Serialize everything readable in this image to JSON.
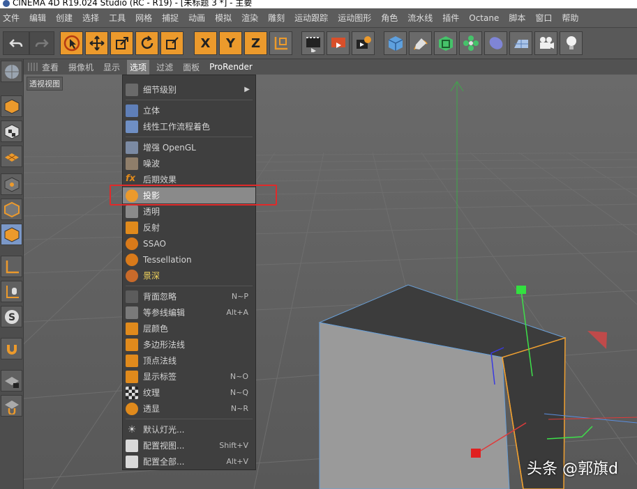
{
  "window": {
    "title": "CINEMA 4D R19.024 Studio (RC - R19) - [未标题 3 *] - 主要"
  },
  "menubar": [
    "文件",
    "编辑",
    "创建",
    "选择",
    "工具",
    "网格",
    "捕捉",
    "动画",
    "模拟",
    "渲染",
    "雕刻",
    "运动跟踪",
    "运动图形",
    "角色",
    "流水线",
    "插件",
    "Octane",
    "脚本",
    "窗口",
    "帮助"
  ],
  "viewport": {
    "menus": [
      "查看",
      "摄像机",
      "显示",
      "选项",
      "过滤",
      "面板",
      "ProRender"
    ],
    "active_menu": "选项",
    "label": "透视视图"
  },
  "options_menu": {
    "items": [
      {
        "label": "细节级别",
        "shortcut": "",
        "submenu": true,
        "icon": "blank-icon",
        "color": "#6a6a6a"
      },
      {
        "label": "立体",
        "shortcut": "",
        "icon": "stereo-glasses-icon",
        "color": "#5f7fb8"
      },
      {
        "label": "线性工作流程着色",
        "shortcut": "",
        "icon": "linear-workflow-icon",
        "color": "#6f8fc4"
      },
      {
        "label": "增强 OpenGL",
        "shortcut": "",
        "icon": "enhanced-opengl-icon",
        "color": "#7b8aa3"
      },
      {
        "label": "噪波",
        "shortcut": "",
        "icon": "noise-icon",
        "color": "#8f7e6a"
      },
      {
        "label": "后期效果",
        "shortcut": "",
        "icon": "post-effects-fx-icon",
        "color": "#e08a1c"
      },
      {
        "label": "投影",
        "shortcut": "",
        "icon": "shadow-projection-icon",
        "color": "#ec9a2c",
        "highlighted": true
      },
      {
        "label": "透明",
        "shortcut": "",
        "icon": "transparency-cube-icon",
        "color": "#8a8a8a"
      },
      {
        "label": "反射",
        "shortcut": "",
        "icon": "reflection-icon",
        "color": "#e08a1c"
      },
      {
        "label": "SSAO",
        "shortcut": "",
        "icon": "ssao-sphere-icon",
        "color": "#d97a1a"
      },
      {
        "label": "Tessellation",
        "shortcut": "",
        "icon": "tessellation-sphere-icon",
        "color": "#d97a1a"
      },
      {
        "label": "景深",
        "shortcut": "",
        "icon": "depth-of-field-icon",
        "color": "#c96a2a",
        "yellow": true
      },
      {
        "label": "背面忽略",
        "shortcut": "N~P",
        "icon": "backface-cull-icon",
        "color": "#5c5c5c"
      },
      {
        "label": "等参线编辑",
        "shortcut": "Alt+A",
        "icon": "isoparm-edit-icon",
        "color": "#7a7a7a"
      },
      {
        "label": "层颜色",
        "shortcut": "",
        "icon": "layer-color-icon",
        "color": "#e08a1c"
      },
      {
        "label": "多边形法线",
        "shortcut": "",
        "icon": "polygon-normals-icon",
        "color": "#e08a1c"
      },
      {
        "label": "顶点法线",
        "shortcut": "",
        "icon": "vertex-normals-icon",
        "color": "#e08a1c"
      },
      {
        "label": "显示标签",
        "shortcut": "N~O",
        "icon": "show-tags-icon",
        "color": "#e08a1c"
      },
      {
        "label": "纹理",
        "shortcut": "N~Q",
        "icon": "texture-checker-icon",
        "color": "#bbbbbb"
      },
      {
        "label": "透显",
        "shortcut": "N~R",
        "icon": "x-ray-icon",
        "color": "#e08a1c"
      },
      {
        "label": "默认灯光...",
        "shortcut": "",
        "icon": "default-light-icon",
        "color": "#9a9a9a"
      },
      {
        "label": "配置视图...",
        "shortcut": "Shift+V",
        "icon": "configure-view-icon",
        "color": "#d9d9d9"
      },
      {
        "label": "配置全部...",
        "shortcut": "Alt+V",
        "icon": "configure-all-icon",
        "color": "#d9d9d9"
      }
    ]
  },
  "toolbar": {
    "buttons": [
      "undo-icon",
      "redo-icon",
      "live-selection-icon",
      "move-icon",
      "scale-icon",
      "rotate-icon",
      "recent-tool-icon",
      "x-axis-lock-icon",
      "y-axis-lock-icon",
      "z-axis-lock-icon",
      "world-coordinates-icon",
      "render-view-icon",
      "render-picture-viewer-icon",
      "render-settings-icon",
      "cube-object-icon",
      "pen-spline-icon",
      "subdivision-icon",
      "array-cloner-icon",
      "deformer-icon",
      "floor-environment-icon",
      "camera-icon",
      "light-icon"
    ],
    "axis_labels": [
      "X",
      "Y",
      "Z"
    ]
  },
  "leftbar": {
    "buttons": [
      "make-editable-icon",
      "model-mode-icon",
      "texture-mode-icon",
      "workplane-icon",
      "points-mode-icon",
      "edges-mode-icon",
      "polygons-mode-icon",
      "axis-mode-icon",
      "tweak-mode-icon",
      "solo-mode-icon",
      "snap-magnet-icon",
      "workplane-lock-icon",
      "workplane-snap-icon"
    ]
  },
  "watermark": "头条 @郭旗d",
  "colors": {
    "accent": "#ec9a2c",
    "highlight_box": "#e02a2a",
    "menu_bg": "#3f3f3f",
    "selection_outline": "#f0a030"
  }
}
